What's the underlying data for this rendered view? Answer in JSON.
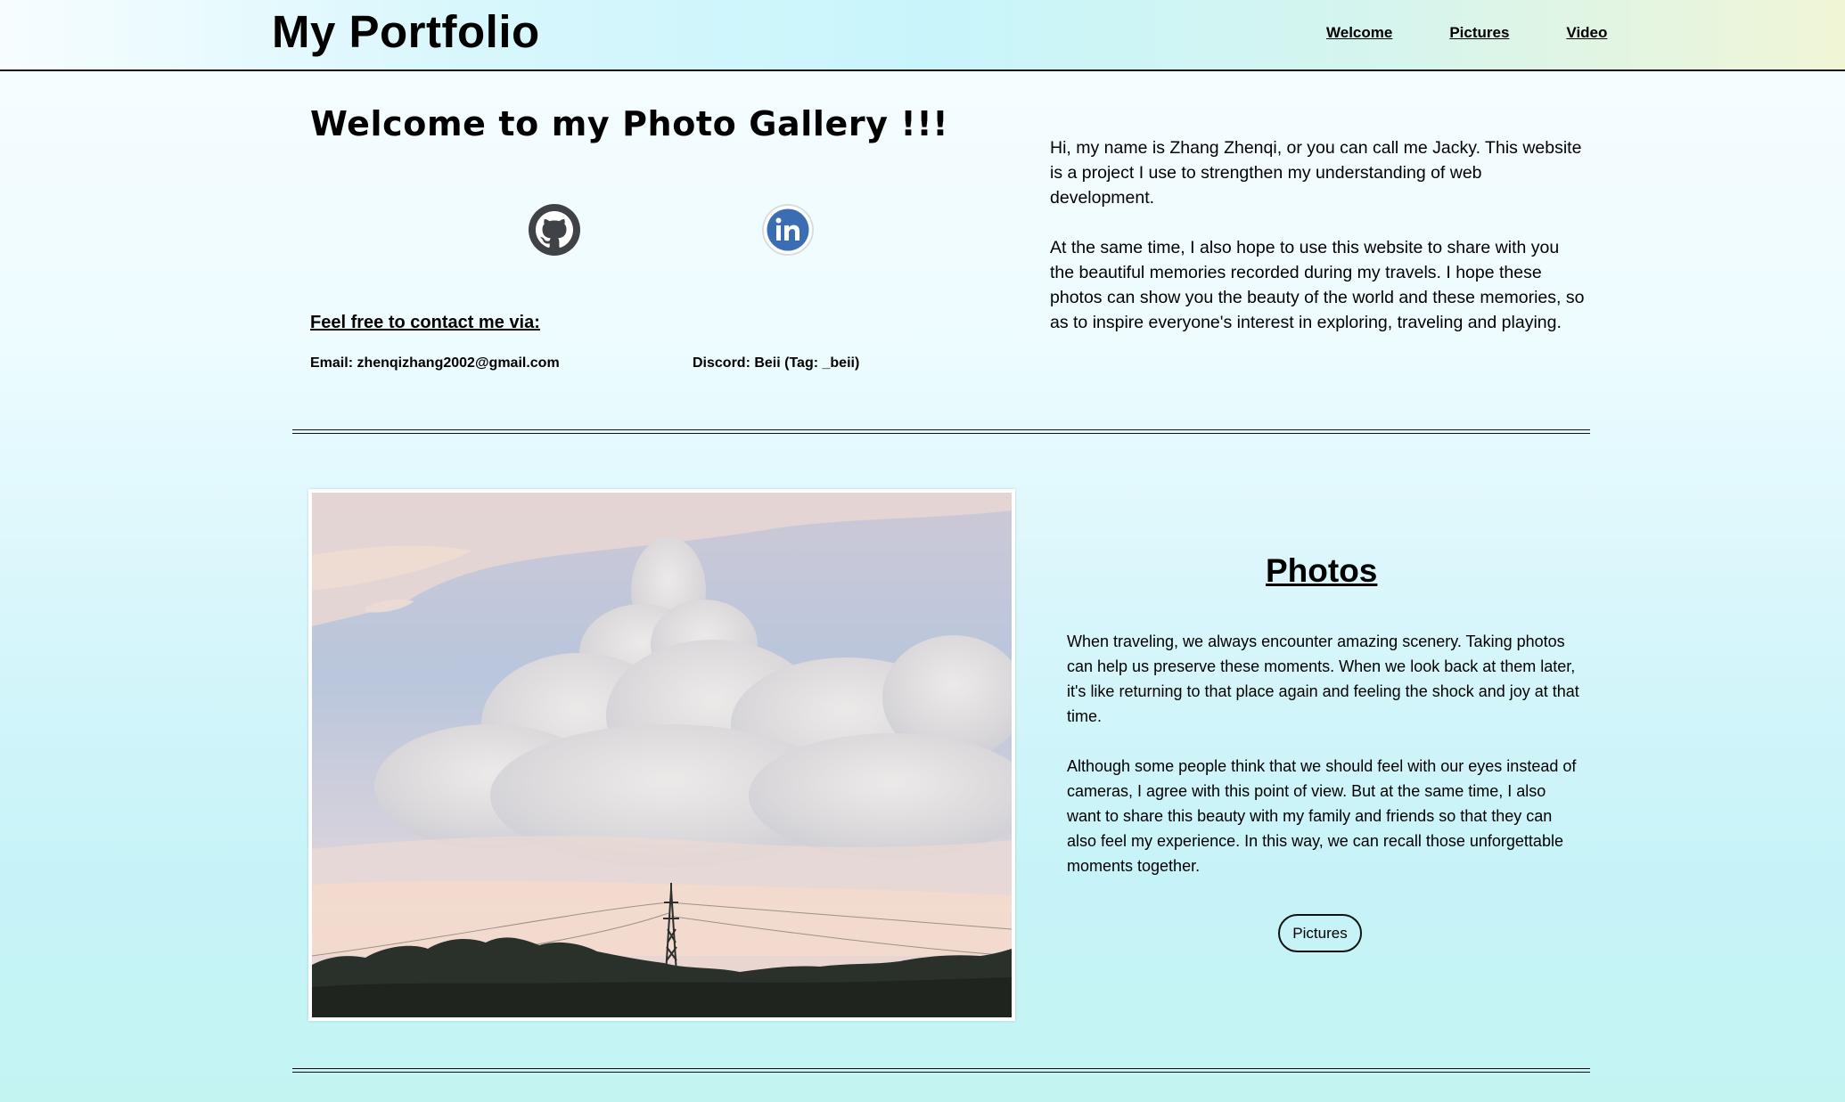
{
  "header": {
    "brand": "My Portfolio",
    "nav": [
      {
        "label": "Welcome"
      },
      {
        "label": "Pictures"
      },
      {
        "label": "Video"
      }
    ]
  },
  "welcome": {
    "title": "Welcome to my Photo Gallery !!!",
    "social": [
      {
        "icon": "github-icon"
      },
      {
        "icon": "linkedin-icon"
      }
    ],
    "contact_title": "Feel free to contact me via:",
    "email": "Email: zhenqizhang2002@gmail.com",
    "discord": "Discord: Beii (Tag: _beii)",
    "intro": [
      "Hi, my name is Zhang Zhenqi, or you can call me Jacky. This website is a project I use to strengthen my understanding of web development.",
      "At the same time, I also hope to use this website to share with you the beautiful memories recorded during my travels. I hope these photos can show you the beauty of the world and these memories, so as to inspire everyone's interest in exploring, traveling and playing."
    ]
  },
  "photos": {
    "title": "Photos",
    "paragraphs": [
      "When traveling, we always encounter amazing scenery. Taking photos can help us preserve these moments. When we look back at them later, it's like returning to that place again and feeling the shock and joy at that time.",
      "Although some people think that we should feel with our eyes instead of cameras, I agree with this point of view. But at the same time, I also want to share this beauty with my family and friends so that they can also feel my experience. In this way, we can recall those unforgettable moments together."
    ],
    "button": "Pictures"
  }
}
